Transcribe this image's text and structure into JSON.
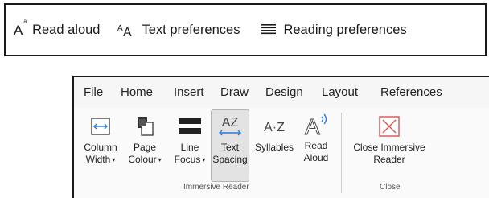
{
  "immersive_toolbar": {
    "read_aloud": {
      "label": "Read aloud",
      "icon": "read-aloud-icon"
    },
    "text_preferences": {
      "label": "Text preferences",
      "icon": "text-preferences-icon"
    },
    "reading_preferences": {
      "label": "Reading preferences",
      "icon": "reading-preferences-icon"
    }
  },
  "ribbon": {
    "tabs": [
      "File",
      "Home",
      "Insert",
      "Draw",
      "Design",
      "Layout",
      "References"
    ],
    "groups": {
      "immersive_reader": "Immersive Reader",
      "close": "Close"
    },
    "buttons": {
      "column_width": {
        "line1": "Column",
        "line2": "Width",
        "icon": "column-width-icon"
      },
      "page_colour": {
        "line1": "Page",
        "line2": "Colour",
        "icon": "page-colour-icon"
      },
      "line_focus": {
        "line1": "Line",
        "line2": "Focus",
        "icon": "line-focus-icon"
      },
      "text_spacing": {
        "line1": "Text",
        "line2": "Spacing",
        "icon": "text-spacing-icon",
        "glyph": "AZ"
      },
      "syllables": {
        "line1": "Syllables",
        "icon": "syllables-icon",
        "glyph": "A·Z"
      },
      "read_aloud": {
        "line1": "Read",
        "line2": "Aloud",
        "icon": "read-aloud-speaker-icon",
        "glyph": "A"
      },
      "close_immersive": {
        "line1": "Close Immersive",
        "line2": "Reader",
        "icon": "close-x-icon"
      }
    },
    "accent_color": "#2b7bd8",
    "close_color": "#d9534f"
  }
}
